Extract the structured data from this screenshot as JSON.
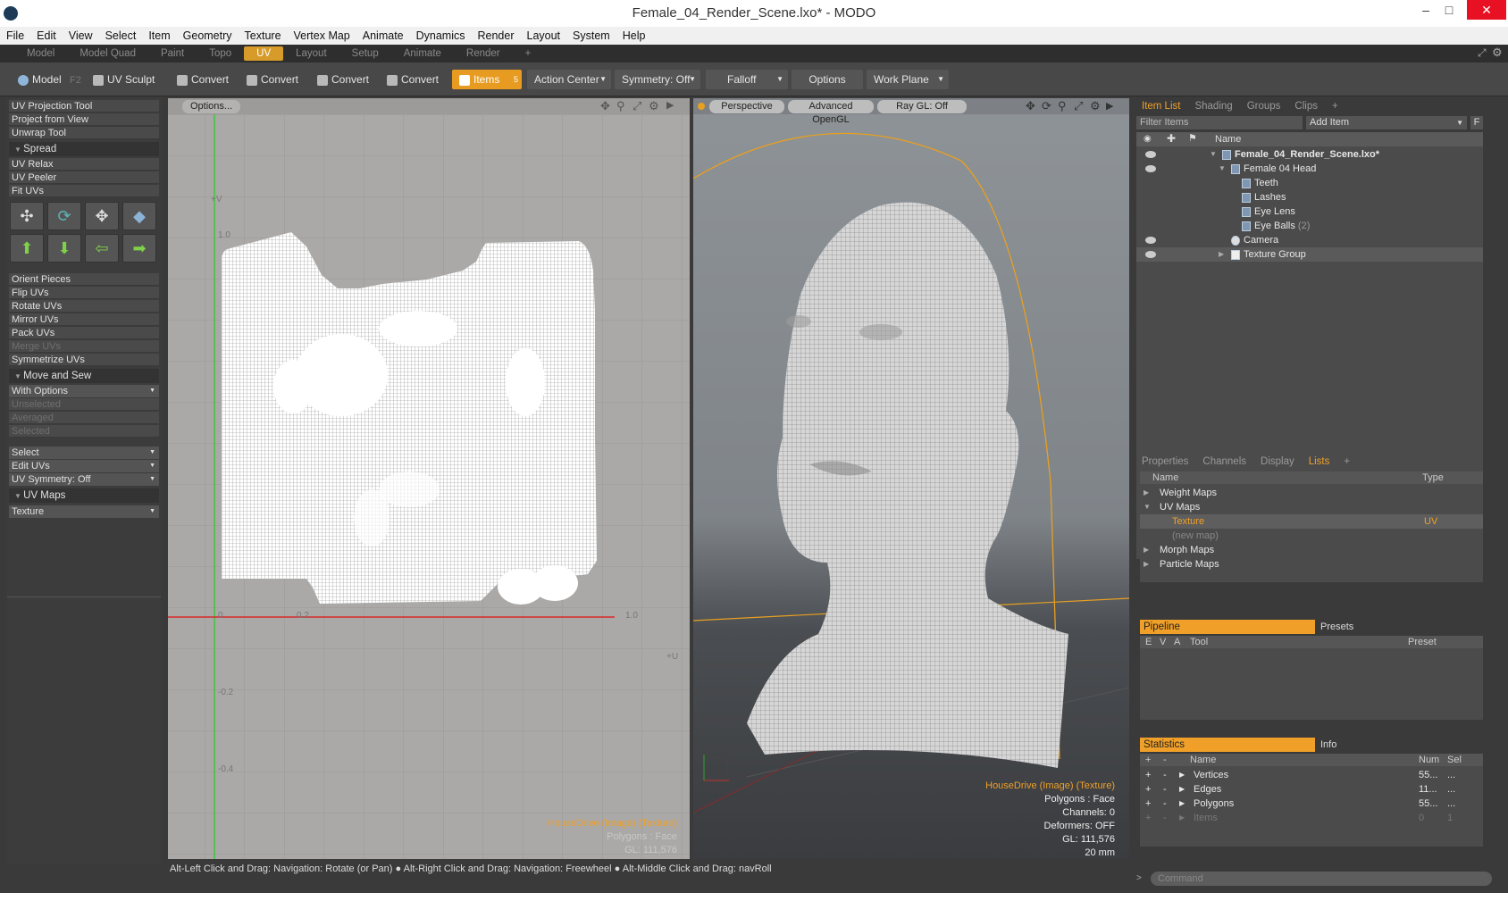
{
  "window": {
    "title": "Female_04_Render_Scene.lxo* - MODO",
    "minimize": "–",
    "maximize": "□",
    "close": "✕"
  },
  "menu": [
    "File",
    "Edit",
    "View",
    "Select",
    "Item",
    "Geometry",
    "Texture",
    "Vertex Map",
    "Animate",
    "Dynamics",
    "Render",
    "Layout",
    "System",
    "Help"
  ],
  "layout_tabs": [
    "Model",
    "Model Quad",
    "Paint",
    "Topo",
    "UV",
    "Layout",
    "Setup",
    "Animate",
    "Render",
    "+"
  ],
  "active_layout_tab": "UV",
  "toolbar": {
    "model": "Model",
    "f2": "F2",
    "uv_sculpt": "UV Sculpt",
    "convert1": "Convert",
    "convert2": "Convert",
    "convert3": "Convert",
    "convert4": "Convert",
    "items": "Items",
    "items_key": "5",
    "action_center": "Action Center",
    "symmetry": "Symmetry: Off",
    "falloff": "Falloff",
    "options": "Options",
    "work_plane": "Work Plane"
  },
  "left_panel": {
    "tools_top": [
      "UV Projection Tool",
      "Project from View",
      "Unwrap Tool"
    ],
    "spread_header": "Spread",
    "spread_items": [
      "UV Relax",
      "UV Peeler",
      "Fit UVs"
    ],
    "orient_items": [
      "Orient Pieces",
      "Flip UVs",
      "Rotate UVs",
      "Mirror UVs",
      "Pack UVs",
      "Merge UVs",
      "Symmetrize UVs"
    ],
    "move_sew_header": "Move and Sew",
    "with_options": "With Options",
    "sew_items": [
      "Unselected",
      "Averaged",
      "Selected"
    ],
    "select_dd": "Select",
    "edit_uvs_dd": "Edit UVs",
    "uv_symmetry_dd": "UV Symmetry: Off",
    "uv_maps_header": "UV Maps",
    "texture_dd": "Texture"
  },
  "uv_viewport": {
    "options": "Options...",
    "axis_v": "+V",
    "axis_u": "+U",
    "ticks_u": [
      "0",
      "0.2",
      "1.0"
    ],
    "ticks_v": [
      "1.0",
      "-0.2",
      "-0.4"
    ],
    "info_image": "HouseDrive (Image) (Texture)",
    "info_polys": "Polygons : Face",
    "info_gl": "GL: 111,576"
  },
  "view3d": {
    "perspective": "Perspective",
    "shading": "Advanced OpenGL",
    "raygl": "Ray GL: Off",
    "info_image": "HouseDrive (Image) (Texture)",
    "info_polys": "Polygons : Face",
    "info_channels": "Channels: 0",
    "info_deformers": "Deformers: OFF",
    "info_gl": "GL: 111,576",
    "info_scale": "20 mm"
  },
  "item_list": {
    "tabs": [
      "Item List",
      "Shading",
      "Groups",
      "Clips",
      "+"
    ],
    "filter_placeholder": "Filter Items",
    "add_item": "Add Item",
    "f_button": "F",
    "name_header": "Name",
    "items": [
      {
        "label": "Female_04_Render_Scene.lxo*",
        "level": 0,
        "bold": true
      },
      {
        "label": "Female 04 Head",
        "level": 1
      },
      {
        "label": "Teeth",
        "level": 2
      },
      {
        "label": "Lashes",
        "level": 2
      },
      {
        "label": "Eye Lens",
        "level": 2
      },
      {
        "label": "Eye Balls",
        "level": 2,
        "count": "(2)"
      },
      {
        "label": "Camera",
        "level": 1
      },
      {
        "label": "Texture Group",
        "level": 1
      }
    ]
  },
  "lists_panel": {
    "tabs": [
      "Properties",
      "Channels",
      "Display",
      "Lists",
      "+"
    ],
    "name_header": "Name",
    "type_header": "Type",
    "rows": [
      {
        "label": "Weight Maps",
        "type": ""
      },
      {
        "label": "UV Maps",
        "type": ""
      },
      {
        "label": "Texture",
        "type": "UV"
      },
      {
        "label": "(new map)",
        "type": ""
      },
      {
        "label": "Morph Maps",
        "type": ""
      },
      {
        "label": "Particle Maps",
        "type": ""
      }
    ]
  },
  "pipeline": {
    "tab": "Pipeline",
    "presets": "Presets",
    "cols": [
      "E",
      "V",
      "A",
      "Tool",
      "Preset"
    ]
  },
  "statistics": {
    "tab": "Statistics",
    "info": "Info",
    "name_header": "Name",
    "num_header": "Num",
    "sel_header": "Sel",
    "rows": [
      {
        "label": "Vertices",
        "num": "55...",
        "sel": "..."
      },
      {
        "label": "Edges",
        "num": "11...",
        "sel": "..."
      },
      {
        "label": "Polygons",
        "num": "55...",
        "sel": "..."
      },
      {
        "label": "Items",
        "num": "0",
        "sel": "1"
      }
    ]
  },
  "status": {
    "hint1": "Alt-Left Click and Drag: Navigation: Rotate (or Pan)",
    "hint2": "Alt-Right Click and Drag: Navigation: Freewheel",
    "hint3": "Alt-Middle Click and Drag: navRoll",
    "command_placeholder": "Command"
  },
  "colors": {
    "accent": "#e89b21",
    "selected_text": "#f0a028"
  }
}
